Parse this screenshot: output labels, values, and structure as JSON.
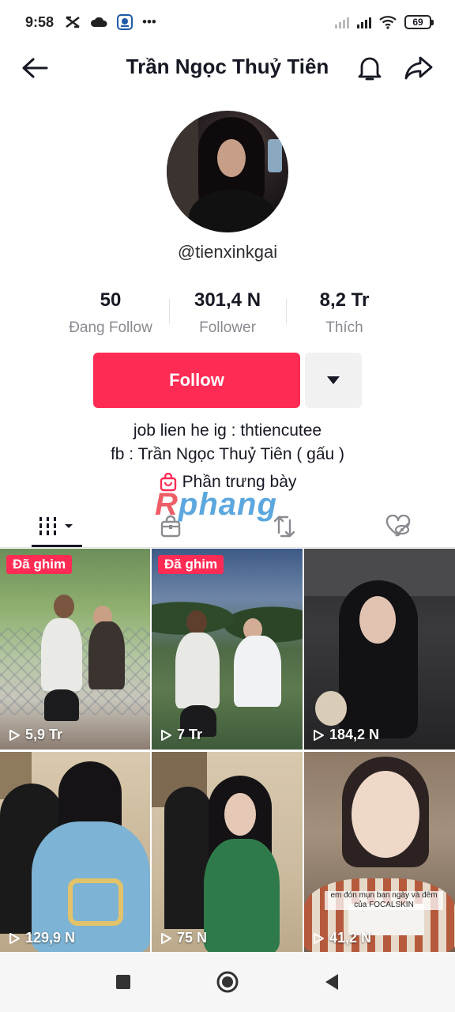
{
  "status_bar": {
    "time": "9:58",
    "battery": "69"
  },
  "header": {
    "title": "Trần Ngọc Thuỷ Tiên"
  },
  "profile": {
    "username": "@tienxinkgai",
    "stats": [
      {
        "value": "50",
        "label": "Đang Follow"
      },
      {
        "value": "301,4 N",
        "label": "Follower"
      },
      {
        "value": "8,2 Tr",
        "label": "Thích"
      }
    ],
    "follow_label": "Follow",
    "bio_lines": [
      "job lien he ig : thtiencutee",
      "fb : Trần Ngọc Thuỷ Tiên ( gấu )"
    ],
    "showcase_label": "Phần trưng bày"
  },
  "watermark": {
    "first": "R",
    "rest": "phang"
  },
  "tabs": [
    {
      "name": "videos-grid-icon",
      "active": true
    },
    {
      "name": "shop-bag-icon",
      "active": false
    },
    {
      "name": "repost-icon",
      "active": false
    },
    {
      "name": "liked-hidden-icon",
      "active": false
    }
  ],
  "videos": [
    {
      "pinned": true,
      "pin_label": "Đã ghim",
      "views": "5,9 Tr"
    },
    {
      "pinned": true,
      "pin_label": "Đã ghim",
      "views": "7 Tr"
    },
    {
      "pinned": false,
      "views": "184,2 N"
    },
    {
      "pinned": false,
      "views": "129,9 N"
    },
    {
      "pinned": false,
      "views": "75 N"
    },
    {
      "pinned": false,
      "views": "41,2 N",
      "caption_line1": "em đón mụn ban ngày và đêm",
      "caption_line2": "của FOCALSKIN"
    }
  ],
  "colors": {
    "accent": "#fe2c55",
    "text": "#161823",
    "muted": "#8a8b91"
  }
}
